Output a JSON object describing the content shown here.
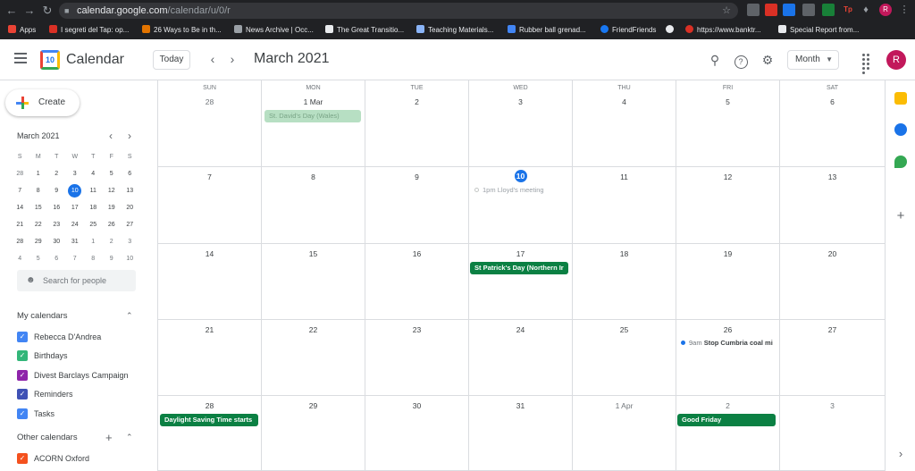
{
  "browser": {
    "url_host": "calendar.google.com",
    "url_path": "/calendar/u/0/r",
    "bookmarks": [
      {
        "label": "Apps"
      },
      {
        "label": "I segreti del Tap: op..."
      },
      {
        "label": "26 Ways to Be in th..."
      },
      {
        "label": "News Archive | Occ..."
      },
      {
        "label": "The Great Transitio..."
      },
      {
        "label": "Teaching Materials..."
      },
      {
        "label": "Rubber ball grenad..."
      },
      {
        "label": "FriendFriends"
      },
      {
        "label": ""
      },
      {
        "label": "https://www.banktr..."
      },
      {
        "label": "Special Report from..."
      }
    ],
    "profile_initial": "R"
  },
  "header": {
    "app_name": "Calendar",
    "logo_day": "10",
    "today_label": "Today",
    "title": "March 2021",
    "view_label": "Month",
    "avatar_initial": "R"
  },
  "sidebar": {
    "create_label": "Create",
    "mini_title": "March 2021",
    "mini_days": [
      "S",
      "M",
      "T",
      "W",
      "T",
      "F",
      "S"
    ],
    "mini_weeks": [
      [
        "28",
        "1",
        "2",
        "3",
        "4",
        "5",
        "6"
      ],
      [
        "7",
        "8",
        "9",
        "10",
        "11",
        "12",
        "13"
      ],
      [
        "14",
        "15",
        "16",
        "17",
        "18",
        "19",
        "20"
      ],
      [
        "21",
        "22",
        "23",
        "24",
        "25",
        "26",
        "27"
      ],
      [
        "28",
        "29",
        "30",
        "31",
        "1",
        "2",
        "3"
      ],
      [
        "4",
        "5",
        "6",
        "7",
        "8",
        "9",
        "10"
      ]
    ],
    "search_placeholder": "Search for people",
    "my_calendars_label": "My calendars",
    "my_calendars": [
      {
        "name": "Rebecca D'Andrea",
        "color": "#4285f4"
      },
      {
        "name": "Birthdays",
        "color": "#33b679"
      },
      {
        "name": "Divest Barclays Campaign",
        "color": "#8e24aa"
      },
      {
        "name": "Reminders",
        "color": "#3f51b5"
      },
      {
        "name": "Tasks",
        "color": "#4285f4"
      }
    ],
    "other_calendars_label": "Other calendars",
    "other_calendars": [
      {
        "name": "ACORN Oxford",
        "color": "#f4511e"
      }
    ]
  },
  "grid": {
    "weekdays": [
      "SUN",
      "MON",
      "TUE",
      "WED",
      "THU",
      "FRI",
      "SAT"
    ],
    "weeks": [
      [
        "28",
        "1 Mar",
        "2",
        "3",
        "4",
        "5",
        "6"
      ],
      [
        "7",
        "8",
        "9",
        "10",
        "11",
        "12",
        "13"
      ],
      [
        "14",
        "15",
        "16",
        "17",
        "18",
        "19",
        "20"
      ],
      [
        "21",
        "22",
        "23",
        "24",
        "25",
        "26",
        "27"
      ],
      [
        "28",
        "29",
        "30",
        "31",
        "1 Apr",
        "2",
        "3"
      ]
    ],
    "today": "10"
  },
  "events": {
    "st_davids": "St. David's Day (Wales)",
    "lloyds_time": "1pm",
    "lloyds_title": "Lloyd's meeting",
    "st_patricks": "St Patrick's Day (Northern Ir",
    "cumbria_time": "9am",
    "cumbria_title": "Stop Cumbria coal mi",
    "dst": "Daylight Saving Time starts",
    "good_friday": "Good Friday"
  },
  "colors": {
    "accent": "#1a73e8",
    "holiday_green": "#0b8043"
  }
}
